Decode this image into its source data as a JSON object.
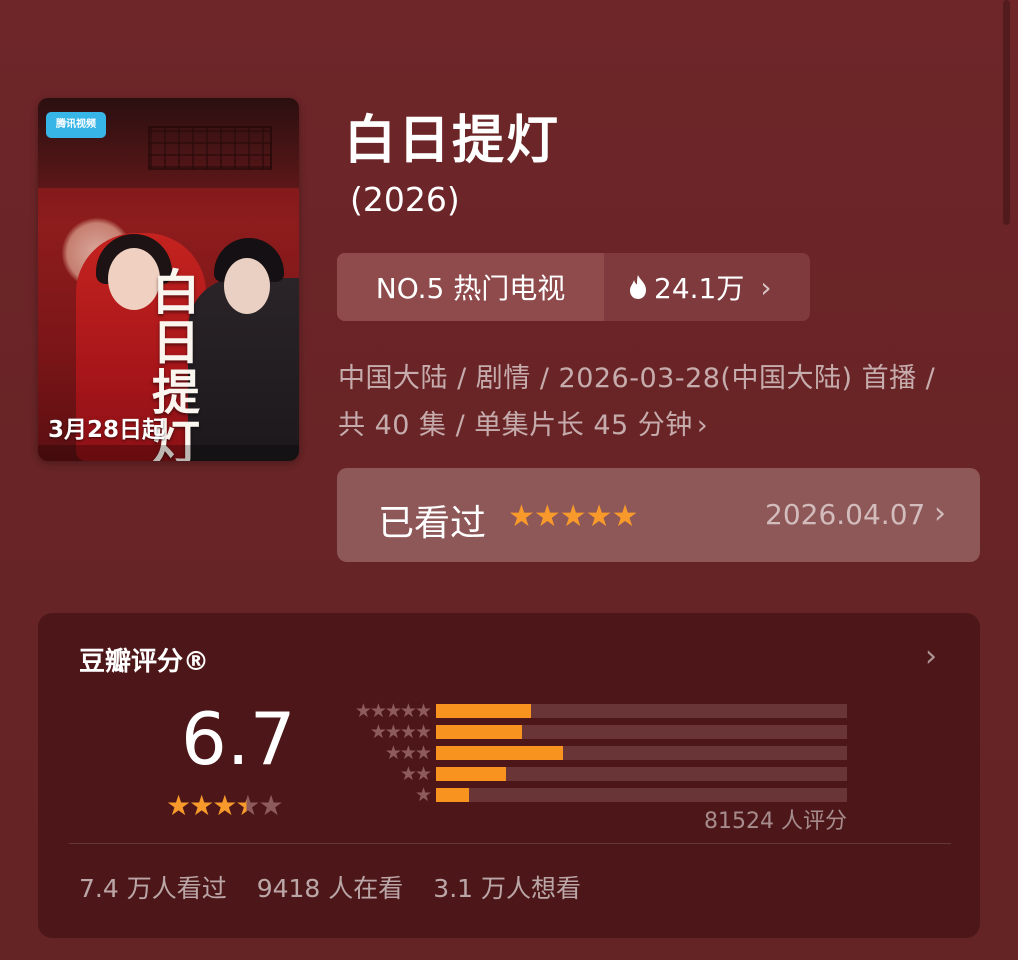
{
  "poster": {
    "logo_text": "腾讯视频",
    "calligraphy": "白日提灯",
    "release_text": "3月28日起"
  },
  "title": "白日提灯",
  "year": "(2026)",
  "rank": {
    "label": "NO.5 热门电视",
    "heat": "24.1万"
  },
  "meta": {
    "line1": "中国大陆 / 剧情 / 2026-03-28(中国大陆) 首播 /",
    "line2": "共 40 集 / 单集片长 45 分钟"
  },
  "watched": {
    "label": "已看过",
    "stars": "★★★★★",
    "date": "2026.04.07"
  },
  "rating": {
    "title": "豆瓣评分®",
    "score": "6.7",
    "stars_value": 3.5,
    "count_text": "81524 人评分",
    "distribution": [
      {
        "stars": "★★★★★",
        "fraction": 0.23
      },
      {
        "stars": "★★★★",
        "fraction": 0.21
      },
      {
        "stars": "★★★",
        "fraction": 0.31
      },
      {
        "stars": "★★",
        "fraction": 0.17
      },
      {
        "stars": "★",
        "fraction": 0.08
      }
    ]
  },
  "stats": {
    "watched": "7.4 万人看过",
    "watching": "9418 人在看",
    "want": "3.1 万人想看"
  },
  "colors": {
    "background": "#6a2527",
    "accent_orange": "#f7931e",
    "card": "#4d1719"
  },
  "icons": {
    "heat": "flame-icon",
    "more": "chevron-right-icon"
  }
}
